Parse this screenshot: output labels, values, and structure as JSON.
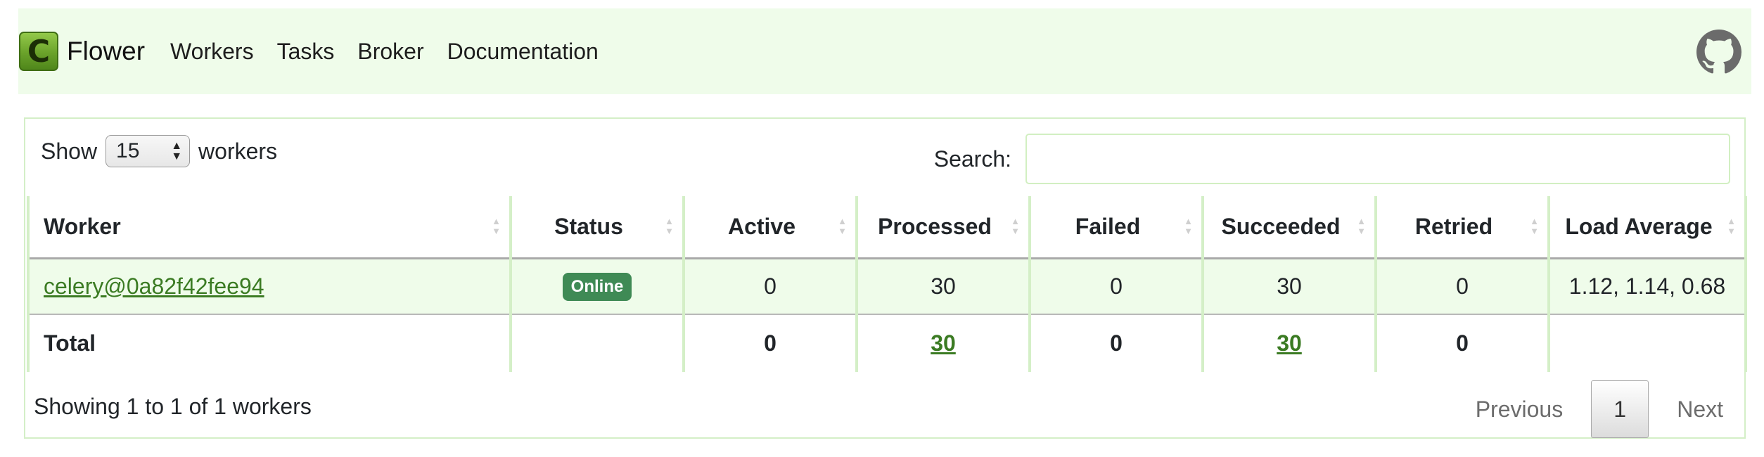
{
  "navbar": {
    "logo_letter": "C",
    "brand": "Flower",
    "links": [
      "Workers",
      "Tasks",
      "Broker",
      "Documentation"
    ],
    "github_icon": "github-icon"
  },
  "controls": {
    "show_label": "Show",
    "page_length": "15",
    "workers_label": "workers",
    "search_label": "Search:",
    "search_value": ""
  },
  "table": {
    "columns": [
      "Worker",
      "Status",
      "Active",
      "Processed",
      "Failed",
      "Succeeded",
      "Retried",
      "Load Average"
    ],
    "rows": [
      {
        "worker": "celery@0a82f42fee94",
        "status": "Online",
        "active": "0",
        "processed": "30",
        "failed": "0",
        "succeeded": "30",
        "retried": "0",
        "load_average": "1.12, 1.14, 0.68"
      }
    ],
    "total": {
      "label": "Total",
      "active": "0",
      "processed": "30",
      "failed": "0",
      "succeeded": "30",
      "retried": "0"
    }
  },
  "footer": {
    "info": "Showing 1 to 1 of 1 workers",
    "previous": "Previous",
    "page": "1",
    "next": "Next"
  },
  "colors": {
    "navbar_bg": "#effcea",
    "border": "#d4efc7",
    "link": "#3b7b23",
    "badge": "#3f8a55"
  }
}
